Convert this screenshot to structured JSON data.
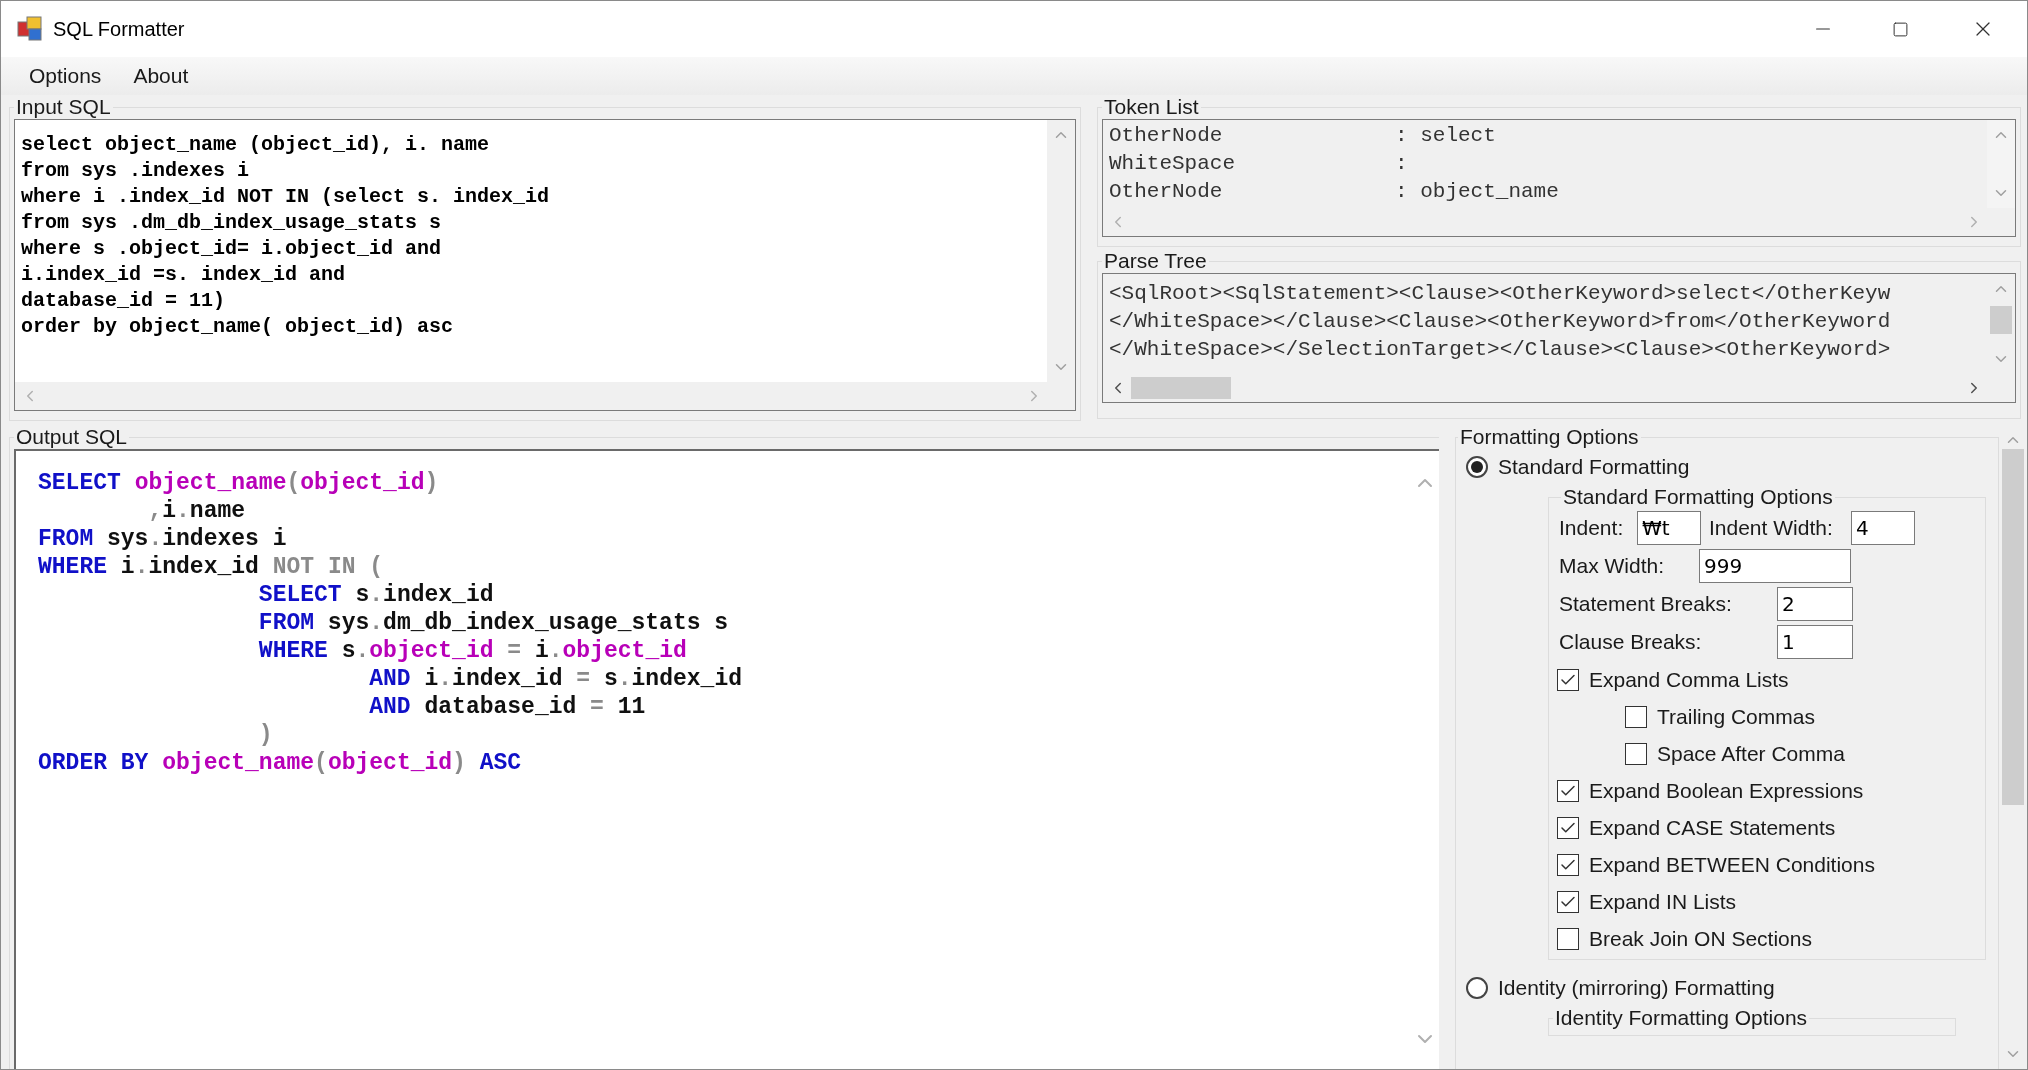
{
  "window": {
    "title": "SQL Formatter"
  },
  "menu": [
    {
      "label": "Options"
    },
    {
      "label": "About"
    }
  ],
  "input_sql": {
    "label": "Input SQL",
    "lines": [
      "select object_name (object_id), i. name",
      "from sys .indexes i",
      "where i .index_id NOT IN (select s. index_id",
      "from sys .dm_db_index_usage_stats s",
      "where s .object_id= i.object_id and",
      "i.index_id =s. index_id and",
      "database_id = 11)",
      "order by object_name( object_id) asc"
    ]
  },
  "token_list": {
    "label": "Token List",
    "rows": [
      {
        "name": "OtherNode",
        "value": ": select"
      },
      {
        "name": "WhiteSpace",
        "value": ":"
      },
      {
        "name": "OtherNode",
        "value": ": object_name"
      }
    ]
  },
  "parse_tree": {
    "label": "Parse Tree",
    "lines": [
      "<SqlRoot><SqlStatement><Clause><OtherKeyword>select</OtherKeyw",
      "</WhiteSpace></Clause><Clause><OtherKeyword>from</OtherKeyword",
      "</WhiteSpace></SelectionTarget></Clause><Clause><OtherKeyword>"
    ]
  },
  "output_sql": {
    "label": "Output SQL",
    "lines": [
      [
        {
          "kind": "keyword",
          "text": "SELECT "
        },
        {
          "kind": "function",
          "text": "object_name"
        },
        {
          "kind": "operator",
          "text": "("
        },
        {
          "kind": "function",
          "text": "object_id"
        },
        {
          "kind": "operator",
          "text": ")"
        }
      ],
      {
        "kind": "continuation",
        "segments": [
          {
            "kind": "operator",
            "text": ","
          },
          {
            "kind": "plain",
            "text": "i"
          },
          {
            "kind": "operator",
            "text": "."
          },
          {
            "kind": "plain",
            "text": "name"
          }
        ]
      },
      [
        {
          "kind": "keyword",
          "text": "FROM "
        },
        {
          "kind": "plain",
          "text": "sys"
        },
        {
          "kind": "operator",
          "text": "."
        },
        {
          "kind": "plain",
          "text": "indexes i"
        }
      ],
      [
        {
          "kind": "keyword",
          "text": "WHERE "
        },
        {
          "kind": "plain",
          "text": "i"
        },
        {
          "kind": "operator",
          "text": "."
        },
        {
          "kind": "plain",
          "text": "index_id "
        },
        {
          "kind": "operator",
          "text": "NOT IN ("
        }
      ],
      {
        "kind": "subquery",
        "segments": [
          {
            "kind": "keyword",
            "text": "SELECT "
          },
          {
            "kind": "plain",
            "text": "s"
          },
          {
            "kind": "operator",
            "text": "."
          },
          {
            "kind": "plain",
            "text": "index_id"
          }
        ]
      },
      {
        "kind": "subquery",
        "segments": [
          {
            "kind": "keyword",
            "text": "FROM "
          },
          {
            "kind": "plain",
            "text": "sys"
          },
          {
            "kind": "operator",
            "text": "."
          },
          {
            "kind": "plain",
            "text": "dm_db_index_usage_stats s"
          }
        ]
      },
      {
        "kind": "subquery",
        "segments": [
          {
            "kind": "keyword",
            "text": "WHERE "
          },
          {
            "kind": "plain",
            "text": "s"
          },
          {
            "kind": "operator",
            "text": "."
          },
          {
            "kind": "function",
            "text": "object_id"
          },
          {
            "kind": "operator",
            "text": " = "
          },
          {
            "kind": "plain",
            "text": "i"
          },
          {
            "kind": "operator",
            "text": "."
          },
          {
            "kind": "function",
            "text": "object_id"
          }
        ]
      },
      {
        "kind": "condition",
        "segments": [
          {
            "kind": "keyword",
            "text": "AND "
          },
          {
            "kind": "plain",
            "text": "i"
          },
          {
            "kind": "operator",
            "text": "."
          },
          {
            "kind": "plain",
            "text": "index_id"
          },
          {
            "kind": "operator",
            "text": " = "
          },
          {
            "kind": "plain",
            "text": "s"
          },
          {
            "kind": "operator",
            "text": "."
          },
          {
            "kind": "plain",
            "text": "index_id"
          }
        ]
      },
      {
        "kind": "condition",
        "segments": [
          {
            "kind": "keyword",
            "text": "AND "
          },
          {
            "kind": "plain",
            "text": "database_id"
          },
          {
            "kind": "operator",
            "text": " = "
          },
          {
            "kind": "plain",
            "text": "11"
          }
        ]
      },
      {
        "kind": "subquery",
        "segments": [
          {
            "kind": "operator",
            "text": ")"
          }
        ]
      },
      [
        {
          "kind": "keyword",
          "text": "ORDER BY "
        },
        {
          "kind": "function",
          "text": "object_name"
        },
        {
          "kind": "operator",
          "text": "("
        },
        {
          "kind": "function",
          "text": "object_id"
        },
        {
          "kind": "operator",
          "text": ") "
        },
        {
          "kind": "keyword",
          "text": "ASC"
        }
      ]
    ]
  },
  "formatting_options": {
    "label": "Formatting Options",
    "standard": {
      "label": "Standard Formatting",
      "selected": true,
      "options_label": "Standard Formatting Options",
      "field_rows": [
        [
          {
            "label": "Indent:",
            "value": "₩t"
          },
          {
            "label": "Indent Width:",
            "value": "4"
          }
        ],
        [
          {
            "label": "Max Width:",
            "value": "999"
          }
        ],
        [
          {
            "label": "Statement Breaks:",
            "value": "2"
          }
        ],
        [
          {
            "label": "Clause Breaks:",
            "value": "1"
          }
        ]
      ],
      "checkboxes": [
        {
          "label": "Expand Comma Lists",
          "checked": true,
          "children": [
            {
              "label": "Trailing Commas",
              "checked": false
            },
            {
              "label": "Space After Comma",
              "checked": false
            }
          ]
        },
        {
          "label": "Expand Boolean Expressions",
          "checked": true
        },
        {
          "label": "Expand CASE Statements",
          "checked": true
        },
        {
          "label": "Expand BETWEEN Conditions",
          "checked": true
        },
        {
          "label": "Expand IN Lists",
          "checked": true
        },
        {
          "label": "Break Join ON Sections",
          "checked": false
        }
      ]
    },
    "identity": {
      "label": "Identity (mirroring) Formatting",
      "selected": false,
      "options_label": "Identity Formatting Options"
    }
  }
}
